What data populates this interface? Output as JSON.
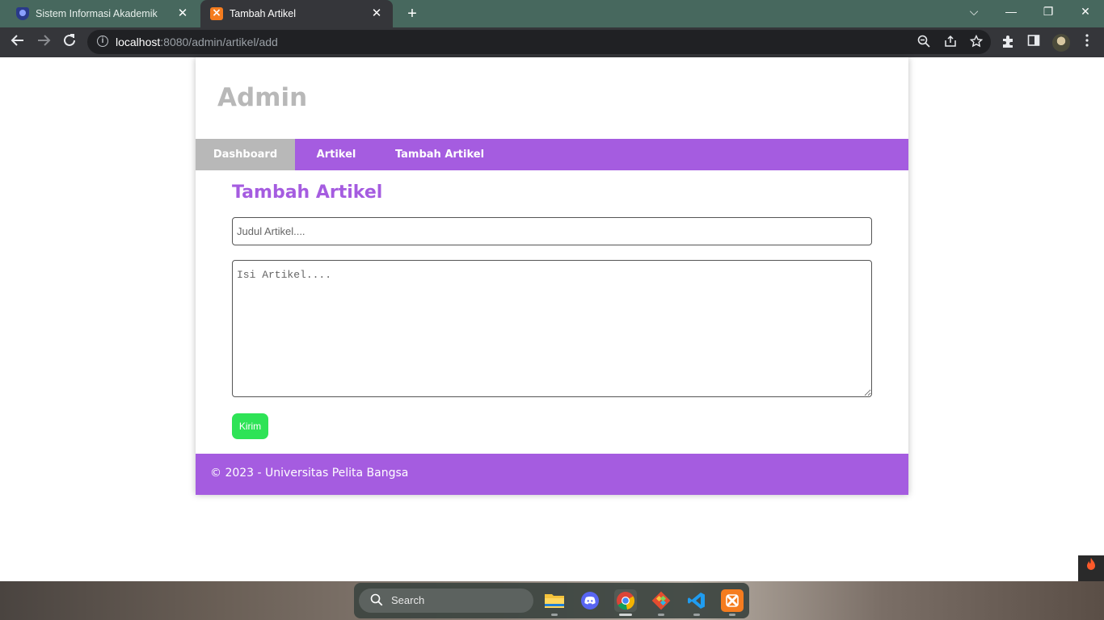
{
  "browser": {
    "tabs": [
      {
        "title": "Sistem Informasi Akademik",
        "icon": "university-icon",
        "active": false
      },
      {
        "title": "Tambah Artikel",
        "icon": "xampp-icon",
        "active": true
      }
    ],
    "new_tab": "+",
    "window_controls": {
      "tab_search": "⌵",
      "minimize": "—",
      "restore": "❐",
      "close": "✕"
    },
    "url": {
      "host": "localhost",
      "rest": ":8080/admin/artikel/add"
    }
  },
  "page": {
    "site_title": "Admin",
    "nav": [
      {
        "label": "Dashboard",
        "active": true
      },
      {
        "label": "Artikel",
        "active": false
      },
      {
        "label": "Tambah Artikel",
        "active": false
      }
    ],
    "form": {
      "title": "Tambah Artikel",
      "judul_placeholder": "Judul Artikel....",
      "isi_placeholder": "Isi Artikel....",
      "submit_label": "Kirim"
    },
    "footer": "© 2023 - Universitas Pelita Bangsa"
  },
  "taskbar": {
    "search_label": "Search",
    "apps": [
      "file-explorer",
      "discord",
      "chrome",
      "git",
      "vscode",
      "xampp"
    ]
  },
  "colors": {
    "accent": "#a55ce0",
    "active_nav": "#b8b8b8",
    "submit": "#2ee356",
    "tabbar": "#47685e",
    "toolbar": "#35363a"
  }
}
